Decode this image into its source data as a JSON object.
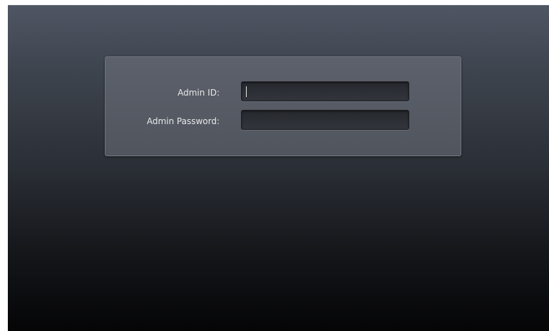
{
  "login": {
    "admin_id_label": "Admin ID:",
    "admin_id_value": "",
    "admin_password_label": "Admin Password:",
    "admin_password_value": ""
  }
}
